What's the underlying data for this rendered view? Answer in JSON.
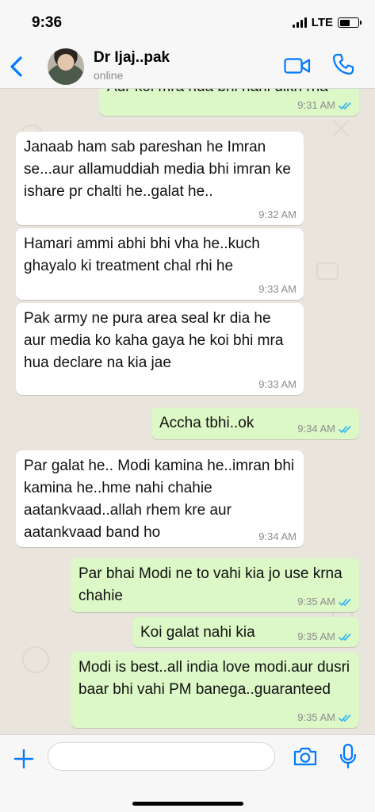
{
  "status_bar": {
    "time": "9:36",
    "network": "LTE",
    "icons": [
      "signal-icon",
      "battery-icon"
    ]
  },
  "header": {
    "contact_name": "Dr Ijaj..pak",
    "contact_status": "online",
    "icons": [
      "back-chevron-icon",
      "avatar",
      "video-call-icon",
      "phone-icon"
    ],
    "accent_color": "#007aff"
  },
  "messages": [
    {
      "direction": "out",
      "text": "Aur koi mra hua bhi nahi dikh rha",
      "time": "9:31 AM",
      "read": true
    },
    {
      "direction": "in",
      "text": "Janaab ham sab pareshan he Imran se...aur allamuddiah media bhi imran ke ishare pr chalti he..galat he..",
      "time": "9:32 AM"
    },
    {
      "direction": "in",
      "text": "Hamari ammi abhi bhi vha he..kuch ghayalo ki treatment chal rhi he",
      "time": "9:33 AM"
    },
    {
      "direction": "in",
      "text": "Pak army ne pura area seal kr dia he aur media ko kaha gaya he koi bhi mra hua declare na kia jae",
      "time": "9:33 AM"
    },
    {
      "direction": "out",
      "text": "Accha tbhi..ok",
      "time": "9:34 AM",
      "read": true
    },
    {
      "direction": "in",
      "text": "Par galat he.. Modi kamina he..imran bhi kamina he..hme nahi chahie aatankvaad..allah rhem kre aur aatankvaad band ho",
      "time": "9:34 AM"
    },
    {
      "direction": "out",
      "text": "Par bhai Modi ne to vahi kia jo use krna chahie",
      "time": "9:35 AM",
      "read": true
    },
    {
      "direction": "out",
      "text": "Koi galat nahi kia",
      "time": "9:35 AM",
      "read": true
    },
    {
      "direction": "out",
      "text": "Modi is best..all india love modi.aur dusri baar bhi vahi PM banega..guaranteed",
      "time": "9:35 AM",
      "read": true
    }
  ],
  "input_bar": {
    "placeholder": "",
    "icons": [
      "plus-icon",
      "camera-icon",
      "microphone-icon"
    ]
  },
  "colors": {
    "outgoing_bubble": "#dcf8c6",
    "incoming_bubble": "#ffffff",
    "chat_background": "#e9e4dc",
    "read_ticks": "#34b7f1"
  }
}
